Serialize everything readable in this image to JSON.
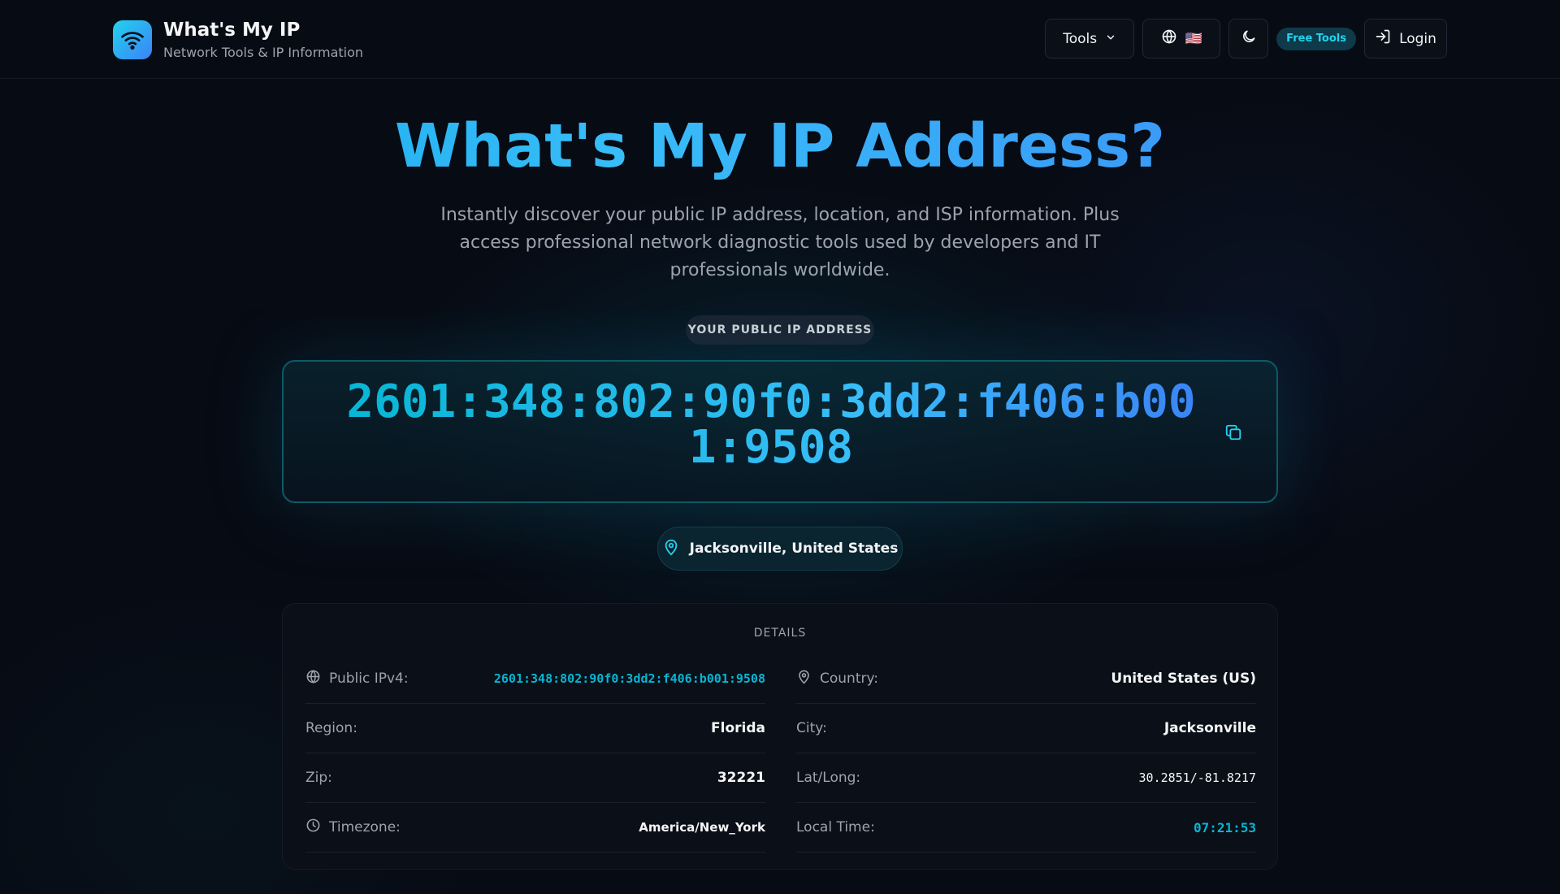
{
  "brand": {
    "title": "What's My IP",
    "subtitle": "Network Tools & IP Information"
  },
  "nav": {
    "tools_label": "Tools",
    "flag": "🇺🇸",
    "free_badge": "Free Tools",
    "login_label": "Login"
  },
  "hero": {
    "title": "What's My IP Address?",
    "description": "Instantly discover your public IP address, location, and ISP information. Plus access professional network diagnostic tools used by developers and IT professionals worldwide."
  },
  "ip": {
    "label": "YOUR PUBLIC IP ADDRESS",
    "value": "2601:348:802:90f0:3dd2:f406:b001:9508",
    "location": "Jacksonville, United States"
  },
  "details": {
    "heading": "DETAILS",
    "public_ipv4_label": "Public IPv4:",
    "public_ipv4_value": "2601:348:802:90f0:3dd2:f406:b001:9508",
    "country_label": "Country:",
    "country_value": "United States (US)",
    "region_label": "Region:",
    "region_value": "Florida",
    "city_label": "City:",
    "city_value": "Jacksonville",
    "zip_label": "Zip:",
    "zip_value": "32221",
    "latlong_label": "Lat/Long:",
    "latlong_value": "30.2851/-81.8217",
    "timezone_label": "Timezone:",
    "timezone_value": "America/New_York",
    "localtime_label": "Local Time:",
    "localtime_value": "07:21:53"
  },
  "colors": {
    "accent": "#06b6d4",
    "brand_blue": "#3b82f6",
    "background": "#070b14"
  },
  "icons": {
    "logo": "wifi-icon",
    "tools": "chevron-down-icon",
    "language": "globe-icon",
    "theme": "moon-icon",
    "login": "login-icon",
    "copy": "copy-icon",
    "location": "map-pin-icon",
    "timezone": "clock-icon"
  }
}
